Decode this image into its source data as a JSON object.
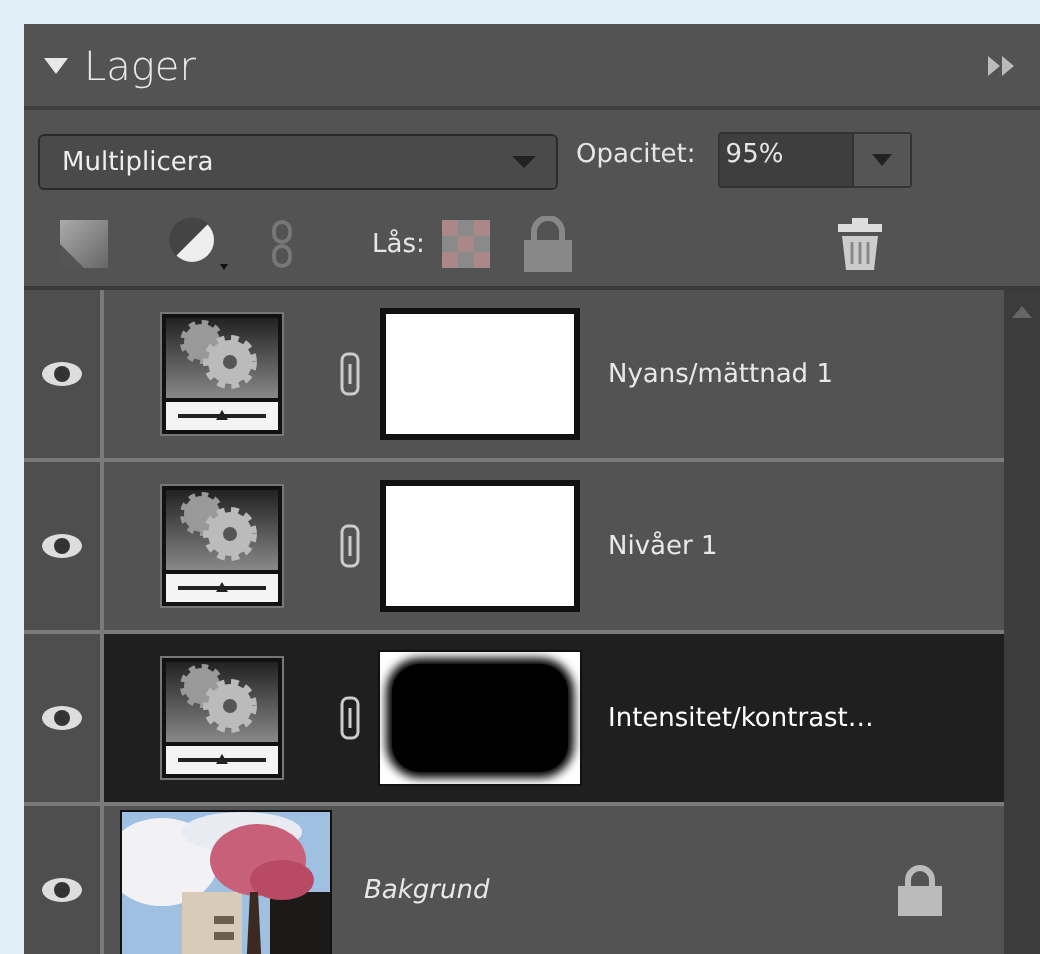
{
  "panel": {
    "title": "Lager",
    "collapsed": false
  },
  "blend_mode": {
    "value": "Multiplicera"
  },
  "opacity": {
    "label": "Opacitet:",
    "value": "95%"
  },
  "lock": {
    "label": "Lås:"
  },
  "layers": [
    {
      "kind": "adjustment",
      "name": "Nyans/mättnad 1",
      "visible": true,
      "selected": false,
      "vignette_mask": false,
      "locked": false
    },
    {
      "kind": "adjustment",
      "name": "Nivåer 1",
      "visible": true,
      "selected": false,
      "vignette_mask": false,
      "locked": false
    },
    {
      "kind": "adjustment",
      "name": "Intensitet/kontrast…",
      "visible": true,
      "selected": true,
      "vignette_mask": true,
      "locked": false
    },
    {
      "name": "Bakgrund",
      "visible": true,
      "selected": false,
      "locked": true
    }
  ]
}
